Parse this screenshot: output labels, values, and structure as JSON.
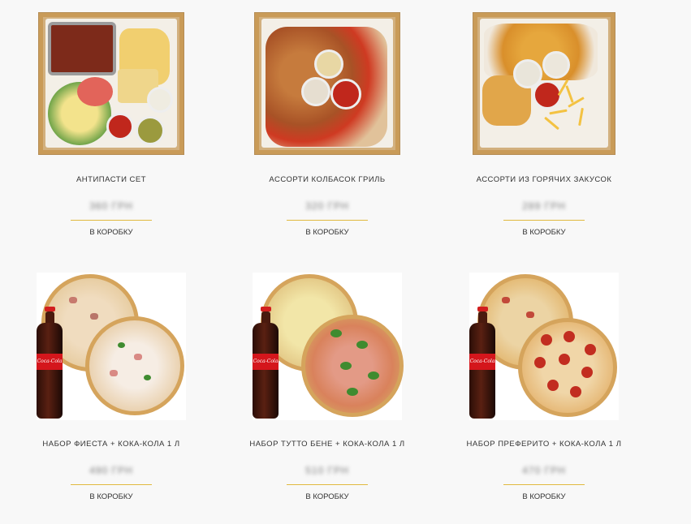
{
  "products": [
    {
      "title": "АНТИПАСТИ СЕТ",
      "price": "360 ГРН",
      "button": "В КОРОБКУ"
    },
    {
      "title": "АССОРТИ КОЛБАСОК ГРИЛЬ",
      "price": "320 ГРН",
      "button": "В КОРОБКУ"
    },
    {
      "title": "АССОРТИ ИЗ ГОРЯЧИХ ЗАКУСОК",
      "price": "289 ГРН",
      "button": "В КОРОБКУ"
    },
    {
      "title": "НАБОР ФИЕСТА + КОКА-КОЛА 1 Л",
      "price": "490 ГРН",
      "button": "В КОРОБКУ"
    },
    {
      "title": "НАБОР ТУТТО БЕНЕ + КОКА-КОЛА 1 Л",
      "price": "510 ГРН",
      "button": "В КОРОБКУ"
    },
    {
      "title": "НАБОР ПРЕФЕРИТО + КОКА-КОЛА 1 Л",
      "price": "470 ГРН",
      "button": "В КОРОБКУ"
    }
  ],
  "bottle_label": "Coca-Cola",
  "colors": {
    "accent_rule": "#e0b93f",
    "text": "#333333",
    "background": "#f8f8f8"
  }
}
